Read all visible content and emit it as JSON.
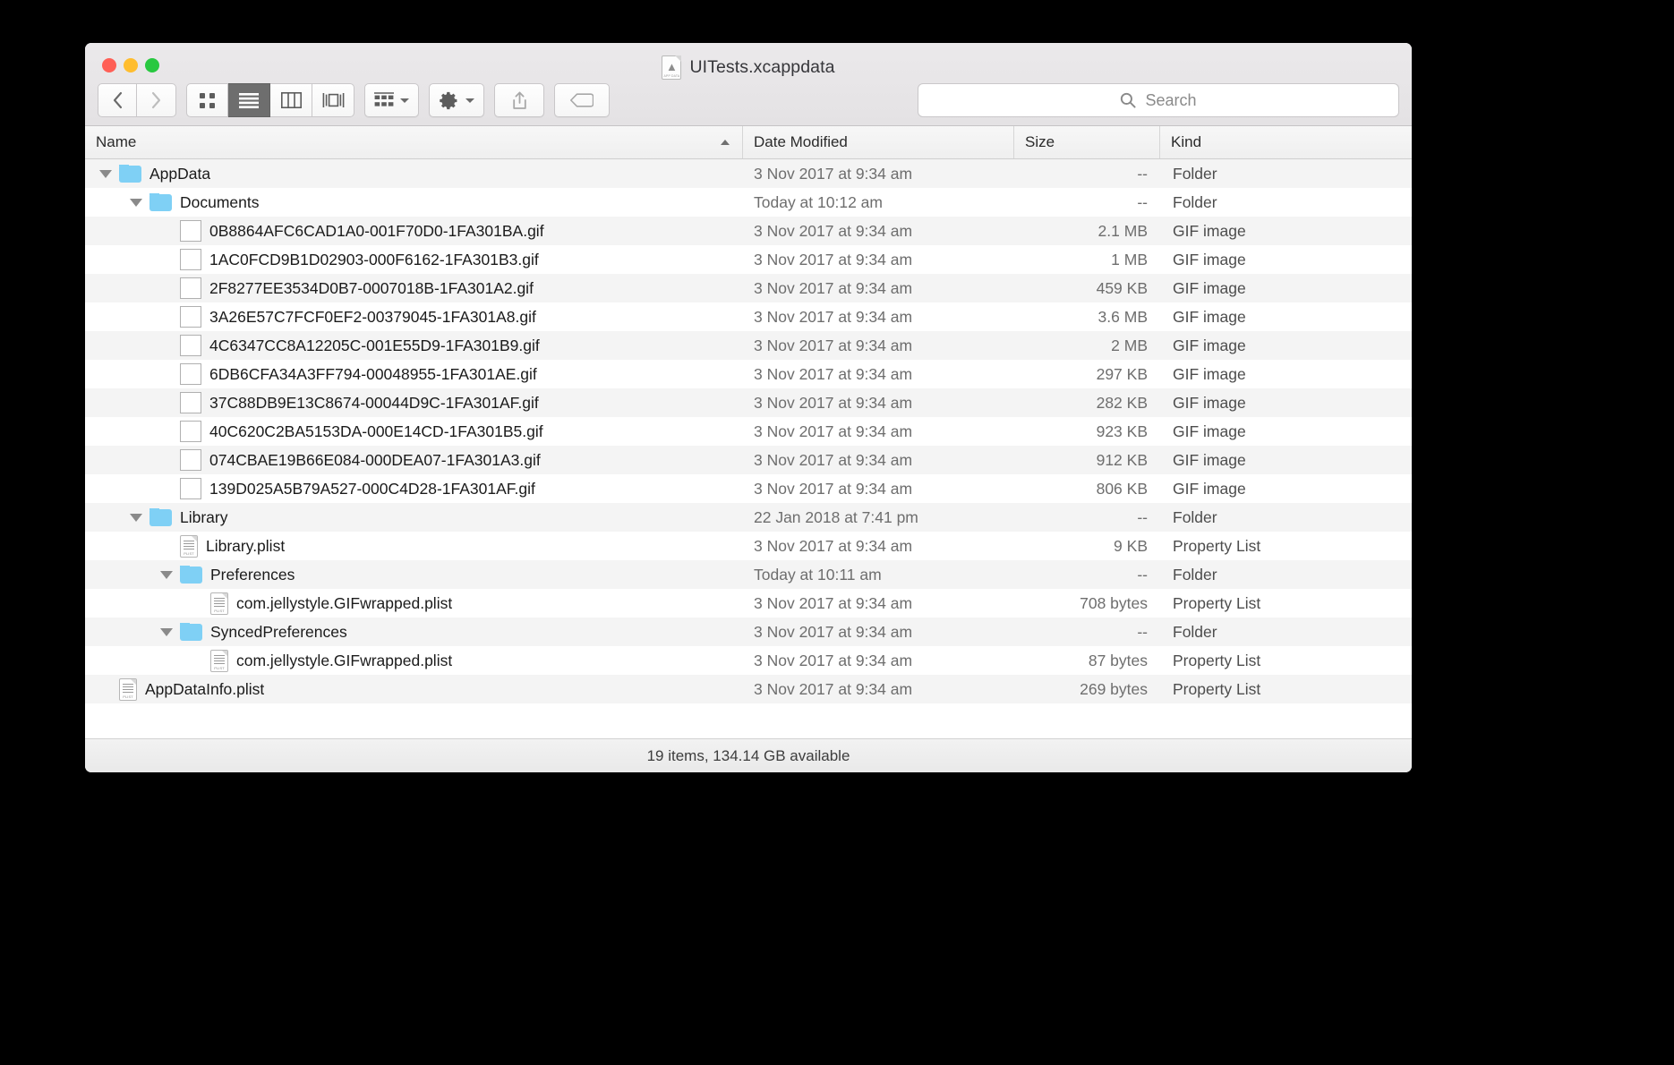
{
  "window": {
    "title": "UITests.xcappdata",
    "title_icon": "xcappdata-document-icon",
    "doc_icon_tag": "APP DATA"
  },
  "toolbar": {
    "back_icon": "chevron-left-icon",
    "forward_icon": "chevron-right-icon",
    "view_icon": "icon-view-icon",
    "list_icon": "list-view-icon",
    "column_icon": "column-view-icon",
    "gallery_icon": "gallery-view-icon",
    "arrange_icon": "arrange-by-icon",
    "action_icon": "gear-icon",
    "share_icon": "share-icon",
    "tag_icon": "tag-icon",
    "search_icon": "search-icon",
    "search_placeholder": "Search"
  },
  "columns": {
    "name": "Name",
    "date_modified": "Date Modified",
    "size": "Size",
    "kind": "Kind",
    "sorted_by": "Name",
    "sort_direction": "ascending"
  },
  "rows": [
    {
      "name": "AppData",
      "date": "3 Nov 2017 at 9:34 am",
      "size": "--",
      "kind": "Folder",
      "icon": "folder-icon",
      "indent": 1,
      "disclosure": "expanded",
      "thumb": ""
    },
    {
      "name": "Documents",
      "date": "Today at 10:12 am",
      "size": "--",
      "kind": "Folder",
      "icon": "folder-icon",
      "indent": 2,
      "disclosure": "expanded",
      "thumb": ""
    },
    {
      "name": "0B8864AFC6CAD1A0-001F70D0-1FA301BA.gif",
      "date": "3 Nov 2017 at 9:34 am",
      "size": "2.1 MB",
      "kind": "GIF image",
      "icon": "gif-thumbnail-icon",
      "indent": 3,
      "disclosure": "none",
      "thumb": "#6d737a"
    },
    {
      "name": "1AC0FCD9B1D02903-000F6162-1FA301B3.gif",
      "date": "3 Nov 2017 at 9:34 am",
      "size": "1 MB",
      "kind": "GIF image",
      "icon": "gif-thumbnail-icon",
      "indent": 3,
      "disclosure": "none",
      "thumb": "#b9bcbe"
    },
    {
      "name": "2F8277EE3534D0B7-0007018B-1FA301A2.gif",
      "date": "3 Nov 2017 at 9:34 am",
      "size": "459 KB",
      "kind": "GIF image",
      "icon": "gif-thumbnail-icon",
      "indent": 3,
      "disclosure": "none",
      "thumb": "#6e4b52"
    },
    {
      "name": "3A26E57C7FCF0EF2-00379045-1FA301A8.gif",
      "date": "3 Nov 2017 at 9:34 am",
      "size": "3.6 MB",
      "kind": "GIF image",
      "icon": "gif-thumbnail-icon",
      "indent": 3,
      "disclosure": "none",
      "thumb": "#7f9a72"
    },
    {
      "name": "4C6347CC8A12205C-001E55D9-1FA301B9.gif",
      "date": "3 Nov 2017 at 9:34 am",
      "size": "2 MB",
      "kind": "GIF image",
      "icon": "gif-thumbnail-icon",
      "indent": 3,
      "disclosure": "none",
      "thumb": "#5c5f63"
    },
    {
      "name": "6DB6CFA34A3FF794-00048955-1FA301AE.gif",
      "date": "3 Nov 2017 at 9:34 am",
      "size": "297 KB",
      "kind": "GIF image",
      "icon": "gif-thumbnail-icon",
      "indent": 3,
      "disclosure": "none",
      "thumb": "#8a6a58"
    },
    {
      "name": "37C88DB9E13C8674-00044D9C-1FA301AF.gif",
      "date": "3 Nov 2017 at 9:34 am",
      "size": "282 KB",
      "kind": "GIF image",
      "icon": "gif-thumbnail-icon",
      "indent": 3,
      "disclosure": "none",
      "thumb": "#4f5664"
    },
    {
      "name": "40C620C2BA5153DA-000E14CD-1FA301B5.gif",
      "date": "3 Nov 2017 at 9:34 am",
      "size": "923 KB",
      "kind": "GIF image",
      "icon": "gif-thumbnail-icon",
      "indent": 3,
      "disclosure": "none",
      "thumb": "#c98fae"
    },
    {
      "name": "074CBAE19B66E084-000DEA07-1FA301A3.gif",
      "date": "3 Nov 2017 at 9:34 am",
      "size": "912 KB",
      "kind": "GIF image",
      "icon": "gif-thumbnail-icon",
      "indent": 3,
      "disclosure": "none",
      "thumb": "#4d7a5e"
    },
    {
      "name": "139D025A5B79A527-000C4D28-1FA301AF.gif",
      "date": "3 Nov 2017 at 9:34 am",
      "size": "806 KB",
      "kind": "GIF image",
      "icon": "gif-thumbnail-icon",
      "indent": 3,
      "disclosure": "none",
      "thumb": "#92502a"
    },
    {
      "name": "Library",
      "date": "22 Jan 2018 at 7:41 pm",
      "size": "--",
      "kind": "Folder",
      "icon": "folder-icon",
      "indent": 2,
      "disclosure": "expanded",
      "thumb": ""
    },
    {
      "name": "Library.plist",
      "date": "3 Nov 2017 at 9:34 am",
      "size": "9 KB",
      "kind": "Property List",
      "icon": "plist-icon",
      "indent": 3,
      "disclosure": "none",
      "thumb": ""
    },
    {
      "name": "Preferences",
      "date": "Today at 10:11 am",
      "size": "--",
      "kind": "Folder",
      "icon": "folder-icon",
      "indent": 3,
      "disclosure": "expanded",
      "thumb": ""
    },
    {
      "name": "com.jellystyle.GIFwrapped.plist",
      "date": "3 Nov 2017 at 9:34 am",
      "size": "708 bytes",
      "kind": "Property List",
      "icon": "plist-icon",
      "indent": 4,
      "disclosure": "none",
      "thumb": ""
    },
    {
      "name": "SyncedPreferences",
      "date": "3 Nov 2017 at 9:34 am",
      "size": "--",
      "kind": "Folder",
      "icon": "folder-icon",
      "indent": 3,
      "disclosure": "expanded",
      "thumb": ""
    },
    {
      "name": "com.jellystyle.GIFwrapped.plist",
      "date": "3 Nov 2017 at 9:34 am",
      "size": "87 bytes",
      "kind": "Property List",
      "icon": "plist-icon",
      "indent": 4,
      "disclosure": "none",
      "thumb": ""
    },
    {
      "name": "AppDataInfo.plist",
      "date": "3 Nov 2017 at 9:34 am",
      "size": "269 bytes",
      "kind": "Property List",
      "icon": "plist-icon",
      "indent": 1,
      "disclosure": "none",
      "thumb": ""
    }
  ],
  "statusbar": {
    "text": "19 items, 134.14 GB available"
  },
  "colors": {
    "folder": "#7fd0f5",
    "traffic_red": "#ff5f56",
    "traffic_yellow": "#ffbd2e",
    "traffic_green": "#28c840",
    "active_segment": "#6e6e6e"
  }
}
